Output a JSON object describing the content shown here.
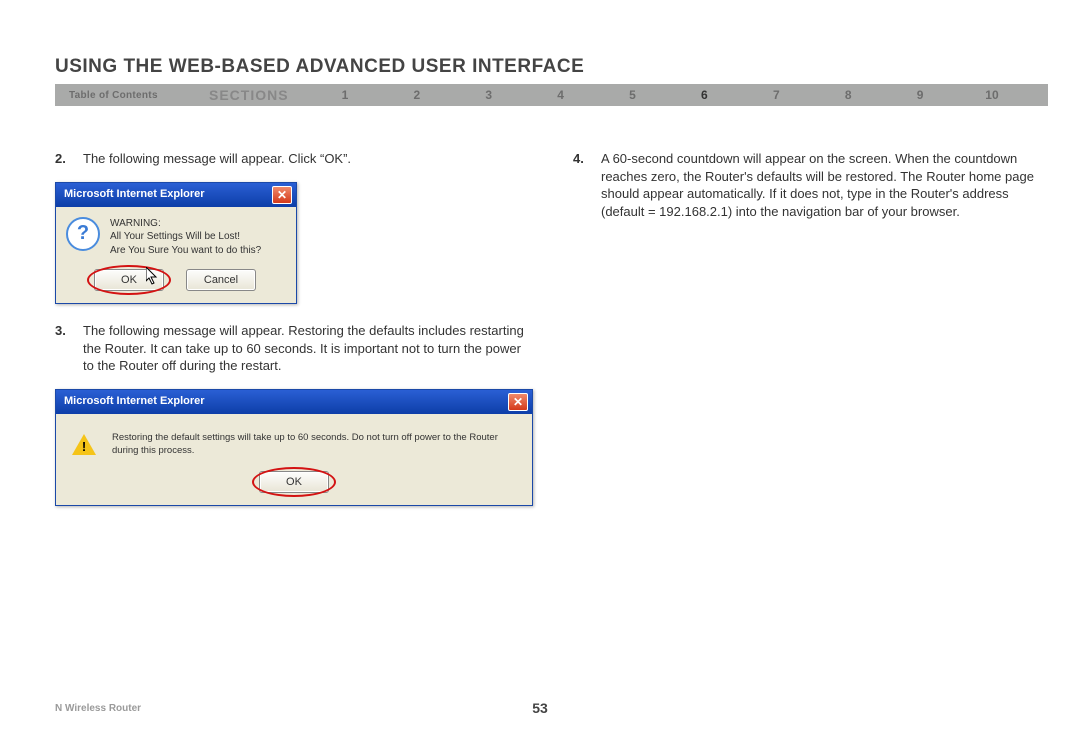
{
  "page_title": "USING THE WEB-BASED ADVANCED USER INTERFACE",
  "nav": {
    "toc": "Table of Contents",
    "sections_label": "SECTIONS",
    "numbers": [
      "1",
      "2",
      "3",
      "4",
      "5",
      "6",
      "7",
      "8",
      "9",
      "10"
    ],
    "active_index": 5
  },
  "steps": {
    "s2_num": "2.",
    "s2_text": "The following message will appear. Click “OK”.",
    "s3_num": "3.",
    "s3_text": "The following message will appear. Restoring the defaults includes restarting the Router. It can take up to 60 seconds. It is important not to turn the power to the Router off during the restart.",
    "s4_num": "4.",
    "s4_text": "A 60-second countdown will appear on the screen. When the countdown reaches zero, the Router's defaults will be restored. The Router home page should appear automatically. If it does not, type in the Router's address (default = 192.168.2.1) into the navigation bar of your browser."
  },
  "dialog1": {
    "title": "Microsoft Internet Explorer",
    "line1": "WARNING:",
    "line2": "All Your Settings Will be Lost!",
    "line3": "Are You Sure You want to do this?",
    "ok": "OK",
    "cancel": "Cancel"
  },
  "dialog2": {
    "title": "Microsoft Internet Explorer",
    "text": "Restoring the default settings will take up to 60 seconds. Do not turn off power to the Router during this process.",
    "ok": "OK"
  },
  "footer": {
    "product": "N Wireless Router",
    "page_num": "53"
  }
}
